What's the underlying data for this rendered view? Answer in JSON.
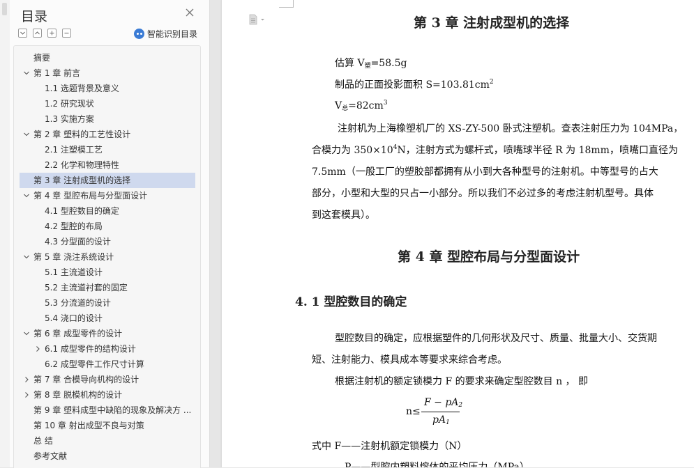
{
  "toc": {
    "title": "目录",
    "smart_label": "智能识别目录",
    "items": [
      {
        "label": "摘要",
        "level": 1,
        "arrow": "none"
      },
      {
        "label": "第 1 章  前言",
        "level": 1,
        "arrow": "down"
      },
      {
        "label": "1.1 选题背景及意义",
        "level": 2,
        "arrow": "none"
      },
      {
        "label": "1.2 研究现状",
        "level": 2,
        "arrow": "none"
      },
      {
        "label": "1.3 实施方案",
        "level": 2,
        "arrow": "none"
      },
      {
        "label": "第 2 章  塑料的工艺性设计",
        "level": 1,
        "arrow": "down"
      },
      {
        "label": "2.1 注塑模工艺",
        "level": 2,
        "arrow": "none"
      },
      {
        "label": "2.2 化学和物理特性",
        "level": 2,
        "arrow": "none"
      },
      {
        "label": "第 3 章  注射成型机的选择",
        "level": 1,
        "arrow": "none",
        "active": true
      },
      {
        "label": "第 4 章  型腔布局与分型面设计",
        "level": 1,
        "arrow": "down"
      },
      {
        "label": "4.1 型腔数目的确定",
        "level": 2,
        "arrow": "none"
      },
      {
        "label": "4.2 型腔的布局",
        "level": 2,
        "arrow": "none"
      },
      {
        "label": "4.3 分型面的设计",
        "level": 2,
        "arrow": "none"
      },
      {
        "label": "第 5 章  浇注系统设计",
        "level": 1,
        "arrow": "down"
      },
      {
        "label": "5.1 主流道设计",
        "level": 2,
        "arrow": "none"
      },
      {
        "label": "5.2 主流道衬套的固定",
        "level": 2,
        "arrow": "none"
      },
      {
        "label": "5.3 分流道的设计",
        "level": 2,
        "arrow": "none"
      },
      {
        "label": "5.4 浇口的设计",
        "level": 2,
        "arrow": "none"
      },
      {
        "label": "第 6 章  成型零件的设计",
        "level": 1,
        "arrow": "down"
      },
      {
        "label": "6.1 成型零件的结构设计",
        "level": 2,
        "arrow": "right"
      },
      {
        "label": "6.2 成型零件工作尺寸计算",
        "level": 2,
        "arrow": "none"
      },
      {
        "label": "第 7 章  合模导向机构的设计",
        "level": 1,
        "arrow": "right"
      },
      {
        "label": "第 8 章  脱模机构的设计",
        "level": 1,
        "arrow": "right"
      },
      {
        "label": "第 9 章  塑料成型中缺陷的现象及解决方 ...",
        "level": 1,
        "arrow": "none"
      },
      {
        "label": "第 10 章  射出成型不良与对策",
        "level": 1,
        "arrow": "none"
      },
      {
        "label": "总      结",
        "level": 1,
        "arrow": "none"
      },
      {
        "label": "参考文献",
        "level": 1,
        "arrow": "none"
      }
    ]
  },
  "doc": {
    "chapter3_title": "第 3 章  注射成型机的选择",
    "line1_pre": "估算 V",
    "line1_sub": "塑",
    "line1_post": "=58.5g",
    "line2_pre": "制品的正面投影面积 S=103.81cm",
    "line2_sup": "2",
    "line3_pre": "V",
    "line3_sub": "总",
    "line3_post": "=82cm",
    "line3_sup": "3",
    "para1_line1": "注射机为上海橡塑机厂的 XS-ZY-500 卧式注塑机。查表注射压力为 104MPa，",
    "para1_line2_pre": "合模力为 350×10",
    "para1_line2_sup": "4",
    "para1_line2_post": "N，注射方式为螺杆式，喷嘴球半径 R 为 18mm，喷嘴口直径为",
    "para1_line3": "7.5mm（一般工厂的塑胶部都拥有从小到大各种型号的注射机。中等型号的占大",
    "para1_line4": "部分，小型和大型的只占一小部分。所以我们不必过多的考虑注射机型号。具体",
    "para1_line5": "到这套模具）。",
    "chapter4_title": "第 4 章  型腔布局与分型面设计",
    "section41_title": "4. 1 型腔数目的确定",
    "para2_line1": "型腔数目的确定，应根据塑件的几何形状及尺寸、质量、批量大小、交货期",
    "para2_line2": "短、注射能力、模具成本等要求来综合考虑。",
    "para3_line1": "根据注射机的额定锁模力 F 的要求来确定型腔数目 n ， 即",
    "formula_lhs": "n≤",
    "formula_num": "F − pA",
    "formula_num_sub": "2",
    "formula_den": "pA",
    "formula_den_sub": "1",
    "where_line": "式中    F——注射机额定锁模力（N）",
    "where_line2": "P——型腔内塑料熔体的平均压力（MPa）"
  }
}
